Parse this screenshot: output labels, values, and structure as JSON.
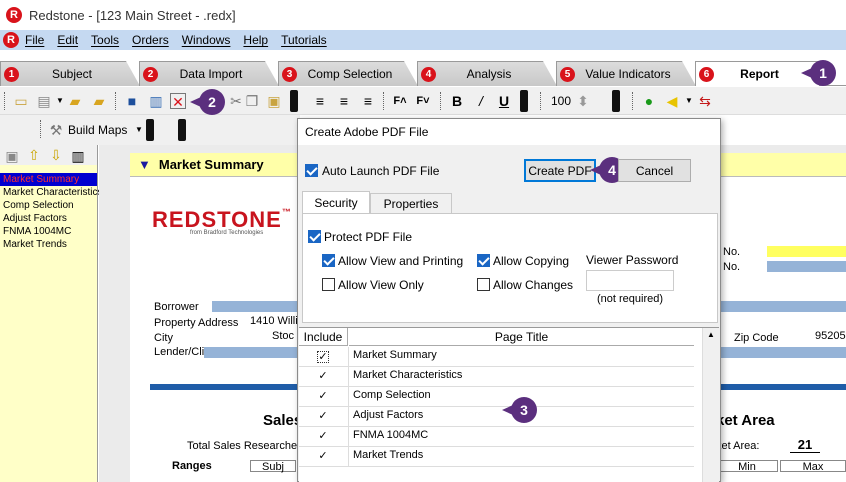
{
  "window": {
    "title": "Redstone - [123 Main Street - .redx]",
    "logo_letter": "R"
  },
  "menu": [
    "File",
    "Edit",
    "Tools",
    "Orders",
    "Windows",
    "Help",
    "Tutorials"
  ],
  "tabs": [
    {
      "num": "1",
      "label": "Subject"
    },
    {
      "num": "2",
      "label": "Data Import"
    },
    {
      "num": "3",
      "label": "Comp Selection"
    },
    {
      "num": "4",
      "label": "Analysis"
    },
    {
      "num": "5",
      "label": "Value Indicators"
    },
    {
      "num": "6",
      "label": "Report",
      "active": true
    }
  ],
  "callouts": [
    "1",
    "2",
    "3",
    "4"
  ],
  "toolbar": {
    "zoom_value": "100",
    "build_maps_label": "Build Maps"
  },
  "left_panel": {
    "items": [
      "Market Summary",
      "Market Characteristics",
      "Comp Selection",
      "Adjust Factors",
      "FNMA 1004MC",
      "Market Trends"
    ],
    "selected": "Market Summary"
  },
  "report": {
    "header_title": "Market Summary",
    "logo_text": "REDSTONE",
    "logo_tm": "™",
    "logo_sub": "from Bradford Technologies",
    "labels": {
      "borrower": "Borrower",
      "property_address": "Property Address",
      "property_address_value": "1410 Willi",
      "city": "City",
      "city_value": "Stoc",
      "lender_client": "Lender/Client",
      "zip_code": "Zip Code",
      "zip_value": "95205",
      "no1": "No.",
      "no2": "No.",
      "sales_partial": "Sales",
      "total_sales_partial": "Total Sales Researche",
      "ranges": "Ranges",
      "subj_partial": "Subj",
      "market_area_title": "ket Area",
      "market_area_label": "ket Area:",
      "market_area_value": "21",
      "min": "Min",
      "max": "Max"
    }
  },
  "dialog": {
    "title": "Create Adobe PDF File",
    "auto_launch_label": "Auto Launch PDF File",
    "create_pdf_button": "Create PDF",
    "cancel_button": "Cancel",
    "tabs": [
      "Security",
      "Properties"
    ],
    "protect_label": "Protect PDF File",
    "allow_view_printing": "Allow View and Printing",
    "allow_copying": "Allow Copying",
    "viewer_password_label": "Viewer Password",
    "allow_view_only": "Allow View Only",
    "allow_changes": "Allow Changes",
    "not_required": "(not required)",
    "grid_headers": [
      "Include",
      "Page Title"
    ],
    "pages": [
      "Market Summary",
      "Market Characteristics",
      "Comp Selection",
      "Adjust Factors",
      "FNMA 1004MC",
      "Market Trends"
    ]
  }
}
